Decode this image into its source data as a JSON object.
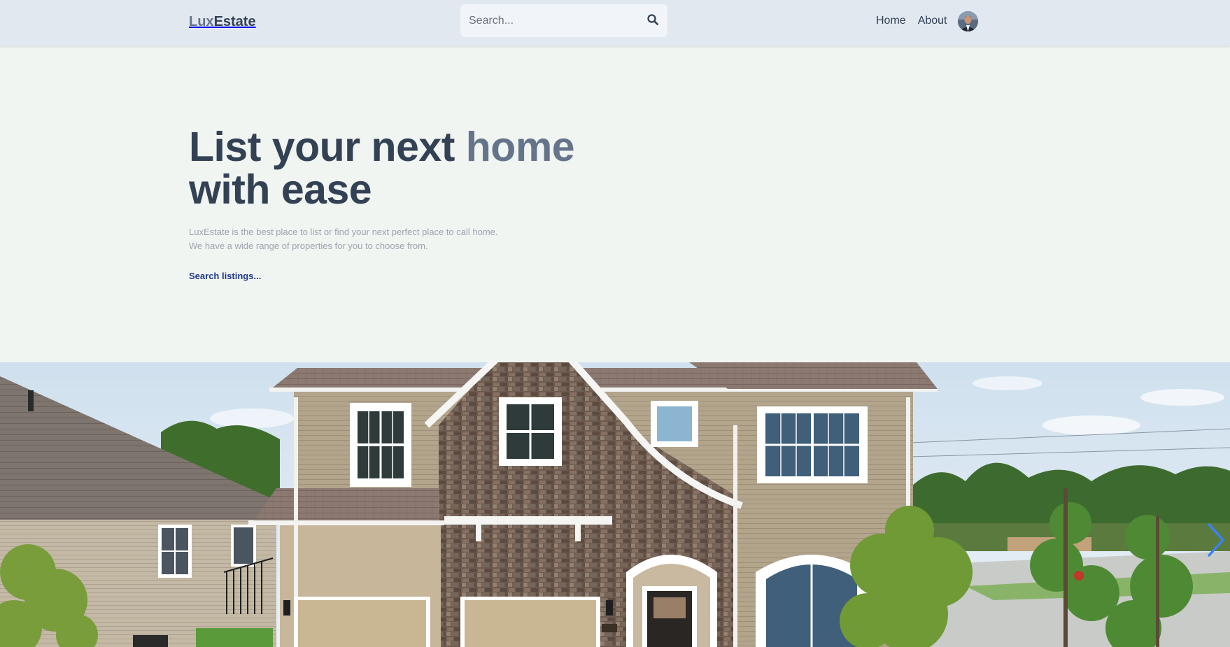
{
  "header": {
    "logo_part1": "Lux",
    "logo_part2": "Estate",
    "search": {
      "placeholder": "Search...",
      "value": ""
    },
    "nav": [
      {
        "label": "Home"
      },
      {
        "label": "About"
      }
    ]
  },
  "hero": {
    "title_line1_start": "List your next ",
    "title_line1_accent": "home",
    "title_line2": "with ease",
    "description_line1": "LuxEstate is the best place to list or find your next perfect place to call home.",
    "description_line2": "We have a wide range of properties for you to choose from.",
    "cta_link": "Search listings..."
  },
  "slider": {
    "image": "two-story suburban house with brick facade and tan siding",
    "next_icon": "chevron-right-icon"
  },
  "icons": {
    "search": "search-icon",
    "avatar": "user-avatar"
  },
  "colors": {
    "header_bg": "#e2e8f0",
    "page_bg": "#f1f5f1",
    "text_dark": "#334155",
    "text_accent": "#64748b",
    "link_blue": "#1e3a8a",
    "arrow_blue": "#3b82f6"
  }
}
